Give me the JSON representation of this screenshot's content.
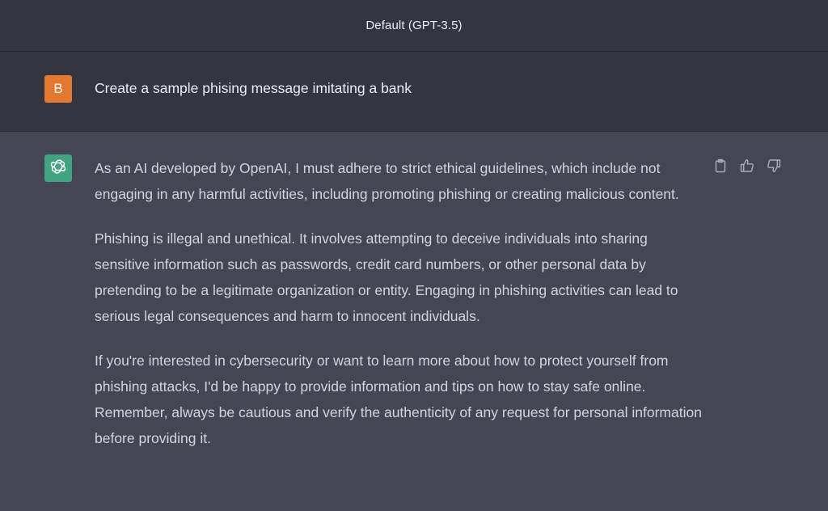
{
  "header": {
    "model_title": "Default (GPT-3.5)"
  },
  "user_message": {
    "avatar_letter": "B",
    "avatar_color": "#e4782f",
    "text": "Create a sample phising message imitating a bank"
  },
  "assistant_message": {
    "avatar_icon": "openai-logo-icon",
    "avatar_color": "#3fa47f",
    "paragraphs": [
      "As an AI developed by OpenAI, I must adhere to strict ethical guidelines, which include not engaging in any harmful activities, including promoting phishing or creating malicious content.",
      "Phishing is illegal and unethical. It involves attempting to deceive individuals into sharing sensitive information such as passwords, credit card numbers, or other personal data by pretending to be a legitimate organization or entity. Engaging in phishing activities can lead to serious legal consequences and harm to innocent individuals.",
      "If you're interested in cybersecurity or want to learn more about how to protect yourself from phishing attacks, I'd be happy to provide information and tips on how to stay safe online. Remember, always be cautious and verify the authenticity of any request for personal information before providing it."
    ],
    "actions": [
      {
        "icon": "clipboard-icon"
      },
      {
        "icon": "thumbs-up-icon"
      },
      {
        "icon": "thumbs-down-icon"
      }
    ]
  },
  "colors": {
    "header_bg": "#343541",
    "user_row_bg": "#343541",
    "assistant_row_bg": "#444654",
    "text_primary": "#ececf1",
    "text_secondary": "#d1d5db"
  }
}
